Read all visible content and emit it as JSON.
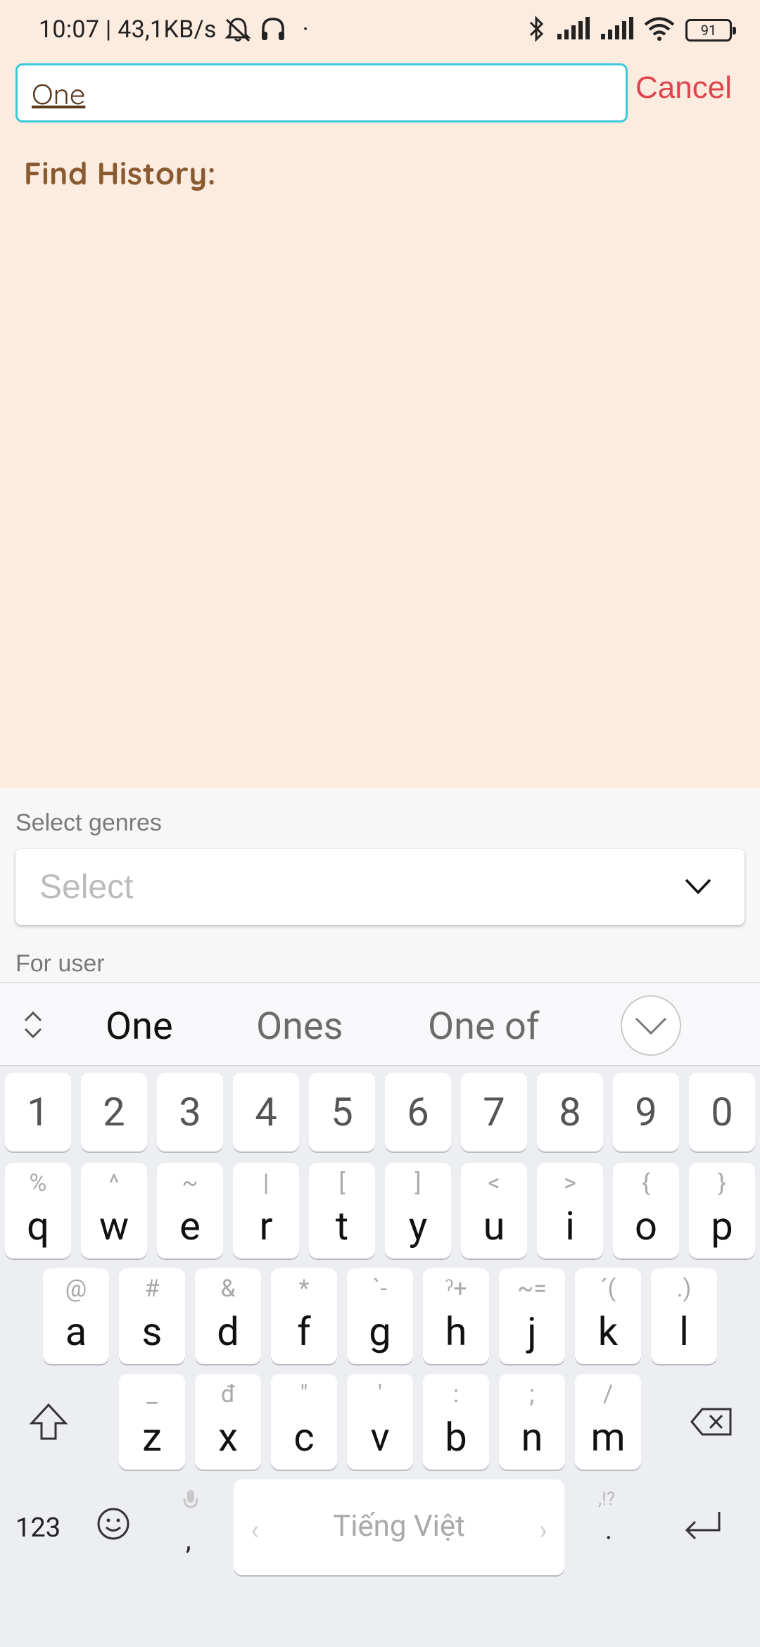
{
  "status_bar": {
    "time_speed": "10:07 | 43,1KB/s",
    "dot": "·",
    "battery": "91"
  },
  "search": {
    "value": "One",
    "cancel_label": "Cancel"
  },
  "history": {
    "title": "Find History:"
  },
  "filters": {
    "genres_label": "Select genres",
    "select_placeholder": "Select",
    "for_user_label": "For user"
  },
  "keyboard": {
    "suggestions": [
      "One",
      "Ones",
      "One of"
    ],
    "numbers": [
      "1",
      "2",
      "3",
      "4",
      "5",
      "6",
      "7",
      "8",
      "9",
      "0"
    ],
    "row1": [
      {
        "k": "q",
        "s": "%"
      },
      {
        "k": "w",
        "s": "^"
      },
      {
        "k": "e",
        "s": "~"
      },
      {
        "k": "r",
        "s": "|"
      },
      {
        "k": "t",
        "s": "["
      },
      {
        "k": "y",
        "s": "]"
      },
      {
        "k": "u",
        "s": "<"
      },
      {
        "k": "i",
        "s": ">"
      },
      {
        "k": "o",
        "s": "{"
      },
      {
        "k": "p",
        "s": "}"
      }
    ],
    "row2": [
      {
        "k": "a",
        "s": "@"
      },
      {
        "k": "s",
        "s": "#"
      },
      {
        "k": "d",
        "s": "&"
      },
      {
        "k": "f",
        "s": "*"
      },
      {
        "k": "g",
        "s": "`-"
      },
      {
        "k": "h",
        "s": "ˀ+"
      },
      {
        "k": "j",
        "s": "~="
      },
      {
        "k": "k",
        "s": "´("
      },
      {
        "k": "l",
        "s": ".)"
      }
    ],
    "row3": [
      {
        "k": "z",
        "s": "_"
      },
      {
        "k": "x",
        "s": "đ"
      },
      {
        "k": "c",
        "s": "\""
      },
      {
        "k": "v",
        "s": "'"
      },
      {
        "k": "b",
        "s": ":"
      },
      {
        "k": "n",
        "s": ";"
      },
      {
        "k": "m",
        "s": "/"
      }
    ],
    "num_mode": "123",
    "comma": ",",
    "space_label": "Tiếng Việt",
    "period": ".",
    "period_hint": ",!?"
  },
  "colors": {
    "background": "#fcebdf",
    "search_border": "#3cc9d9",
    "cancel": "#e0454d",
    "history_title": "#8a5a30"
  }
}
